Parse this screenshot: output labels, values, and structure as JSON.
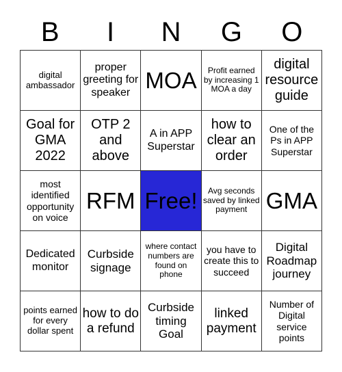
{
  "title_letters": [
    "B",
    "I",
    "N",
    "G",
    "O"
  ],
  "free_color": "#2727d6",
  "cells": [
    [
      "digital ambassador",
      "proper greeting for speaker",
      "MOA",
      "Profit earned by increasing 1 MOA a day",
      "digital resource guide"
    ],
    [
      "Goal for GMA 2022",
      "OTP 2 and above",
      "A in APP Superstar",
      "how to clear an order",
      "One of the Ps in APP Superstar"
    ],
    [
      "most identified opportunity on voice",
      "RFM",
      "Free!",
      "Avg seconds saved by linked payment",
      "GMA"
    ],
    [
      "Dedicated monitor",
      "Curbside signage",
      "where contact numbers are found on phone",
      "you have to create this to succeed",
      "Digital Roadmap journey"
    ],
    [
      "points earned for every dollar spent",
      "how to do a refund",
      "Curbside timing Goal",
      "linked payment",
      "Number of Digital service points"
    ]
  ]
}
